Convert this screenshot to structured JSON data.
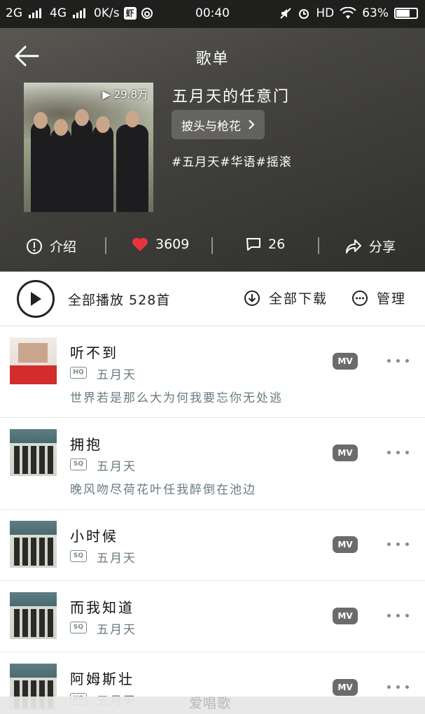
{
  "status_bar": {
    "net1": "2G",
    "net2": "4G",
    "speed": "0K/s",
    "app_badge": "虾",
    "time": "00:40",
    "hd": "HD",
    "battery": "63%"
  },
  "nav": {
    "title": "歌单"
  },
  "playlist": {
    "play_count": "29.8万",
    "name": "五月天的任意门",
    "creator": "披头与枪花",
    "tags": "#五月天#华语#摇滚"
  },
  "actions": {
    "intro_label": "介绍",
    "like_count": "3609",
    "comment_count": "26",
    "share_label": "分享"
  },
  "toolbar": {
    "play_all_label": "全部播放 528首",
    "download_all_label": "全部下载",
    "manage_label": "管理"
  },
  "songs": [
    {
      "title": "听不到",
      "quality": "HQ",
      "artist": "五月天",
      "lyric": "世界若是那么大为何我要忘你无处逃",
      "mv": "MV"
    },
    {
      "title": "拥抱",
      "quality": "SQ",
      "artist": "五月天",
      "lyric": "晚风吻尽荷花叶任我醉倒在池边",
      "mv": "MV"
    },
    {
      "title": "小时候",
      "quality": "SQ",
      "artist": "五月天",
      "mv": "MV"
    },
    {
      "title": "而我知道",
      "quality": "SQ",
      "artist": "五月天",
      "mv": "MV"
    },
    {
      "title": "阿姆斯壮",
      "quality": "HQ",
      "artist": "五月天",
      "mv": "MV"
    }
  ],
  "watermark": "爱唱歌",
  "colors": {
    "header_bg": "#3f3e3b",
    "like_heart": "#e8333c",
    "badge_gray": "#6b6b6b"
  }
}
